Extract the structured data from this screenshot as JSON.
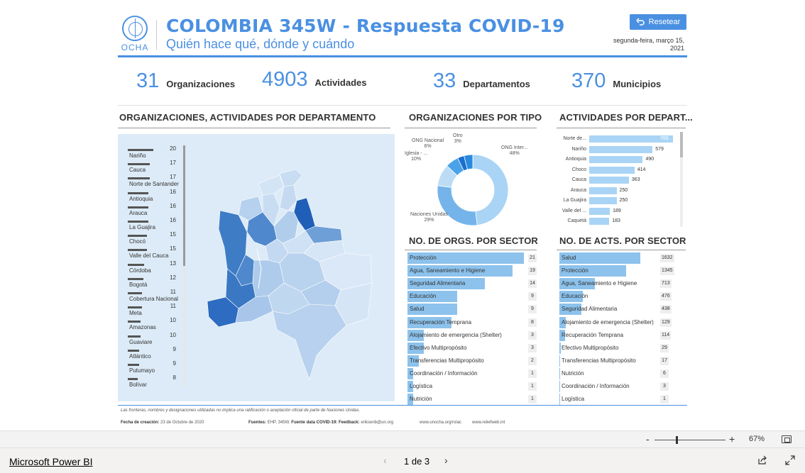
{
  "header": {
    "logo_text": "OCHA",
    "title": "COLOMBIA 345W - Respuesta COVID-19",
    "subtitle": "Quién hace qué, dónde y cuándo",
    "reset_label": "Resetear",
    "date": "segunda-feira, março 15, 2021",
    "accent_color": "#4a90e2"
  },
  "kpis": [
    {
      "value": "31",
      "label": "Organizaciones"
    },
    {
      "value": "4903",
      "label": "Actividades"
    },
    {
      "value": "33",
      "label": "Departamentos"
    },
    {
      "value": "370",
      "label": "Municipios"
    }
  ],
  "sections": {
    "map_title": "ORGANIZACIONES, ACTIVIDADES POR DEPARTAMENTO",
    "tipo_title": "ORGANIZACIONES POR TIPO",
    "act_depto_title": "ACTIVIDADES POR DEPART...",
    "orgs_sector_title": "NO. DE ORGS. POR SECTOR",
    "acts_sector_title": "NO. DE ACTS. POR SECTOR"
  },
  "map_legend": [
    {
      "name": "Nariño",
      "value": 20
    },
    {
      "name": "Cauca",
      "value": 17
    },
    {
      "name": "Norte de Santander",
      "value": 17
    },
    {
      "name": "Antioquia",
      "value": 16
    },
    {
      "name": "Arauca",
      "value": 16
    },
    {
      "name": "La Guajira",
      "value": 16
    },
    {
      "name": "Chocó",
      "value": 15
    },
    {
      "name": "Valle del Cauca",
      "value": 15
    },
    {
      "name": "Córdoba",
      "value": 13
    },
    {
      "name": "Bogotá",
      "value": 12
    },
    {
      "name": "Cobertura Nacional",
      "value": 11
    },
    {
      "name": "Meta",
      "value": 11
    },
    {
      "name": "Amazonas",
      "value": 10
    },
    {
      "name": "Guaviare",
      "value": 10
    },
    {
      "name": "Atlántico",
      "value": 9
    },
    {
      "name": "Putumayo",
      "value": 9
    },
    {
      "name": "Bolívar",
      "value": 8
    }
  ],
  "donut": {
    "segments": [
      {
        "label": "ONG Inter...",
        "pct_label": "48%",
        "value": 48,
        "color": "#a9d4f5"
      },
      {
        "label": "Naciones Unidas",
        "pct_label": "29%",
        "value": 29,
        "color": "#74b4ea"
      },
      {
        "label": "Iglesia - ...",
        "pct_label": "10%",
        "value": 10,
        "color": "#bcdcf5"
      },
      {
        "label": "ONG Nacional",
        "pct_label": "6%",
        "value": 6,
        "color": "#4aa3e8"
      },
      {
        "label": "Otro",
        "pct_label": "3%",
        "value": 3,
        "color": "#1a6fd0"
      },
      {
        "label": "",
        "pct_label": "",
        "value": 4,
        "color": "#2a8ae0"
      }
    ]
  },
  "act_depto": [
    {
      "name": "Norte de...",
      "value": 766
    },
    {
      "name": "Nariño",
      "value": 579
    },
    {
      "name": "Antioquia",
      "value": 490
    },
    {
      "name": "Choco",
      "value": 414
    },
    {
      "name": "Cauca",
      "value": 363
    },
    {
      "name": "Arauca",
      "value": 250
    },
    {
      "name": "La Guajira",
      "value": 250
    },
    {
      "name": "Valle del ...",
      "value": 189
    },
    {
      "name": "Caquetá",
      "value": 183
    }
  ],
  "orgs_sector": [
    {
      "name": "Protección",
      "value": 21
    },
    {
      "name": "Agua, Saneamiento e Higiene",
      "value": 19
    },
    {
      "name": "Seguridad Alimentaria",
      "value": 14
    },
    {
      "name": "Educación",
      "value": 9
    },
    {
      "name": "Salud",
      "value": 9
    },
    {
      "name": "Recuperación Temprana",
      "value": 8
    },
    {
      "name": "Alojamiento de emergencia (Shelter)",
      "value": 3
    },
    {
      "name": "Efectivo Multipropósito",
      "value": 3
    },
    {
      "name": "Transferencias Multipropósito",
      "value": 2
    },
    {
      "name": "Coordinación / Información",
      "value": 1
    },
    {
      "name": "Logística",
      "value": 1
    },
    {
      "name": "Nutrición",
      "value": 1
    }
  ],
  "acts_sector": [
    {
      "name": "Salud",
      "value": 1632
    },
    {
      "name": "Protección",
      "value": 1345
    },
    {
      "name": "Agua, Saneamiento e Higiene",
      "value": 713
    },
    {
      "name": "Educación",
      "value": 476
    },
    {
      "name": "Seguridad Alimentaria",
      "value": 438
    },
    {
      "name": "Alojamiento de emergencia (Shelter)",
      "value": 129
    },
    {
      "name": "Recuperación Temprana",
      "value": 114
    },
    {
      "name": "Efectivo Multipropósito",
      "value": 29
    },
    {
      "name": "Transferencias Multipropósito",
      "value": 17
    },
    {
      "name": "Nutrición",
      "value": 6
    },
    {
      "name": "Coordinación / Información",
      "value": 3
    },
    {
      "name": "Logística",
      "value": 1
    }
  ],
  "footer": {
    "disclaimer": "Las fronteras, nombres y designaciones utilizadas no implica una ratificación o aceptación oficial de parte de Naciones Unidas.",
    "fecha_label": "Fecha de creación:",
    "fecha_value": "23 de Octubre de 2020",
    "fuentes_label": "Fuentes:",
    "fuentes_value": "EHP, 345W.",
    "fuente_covid_label": "Fuente data COVID-19:",
    "feedback_label": "Feedback:",
    "feedback_value": "eriksenb@un.org",
    "url1": "www.unocha.org/rolac",
    "url2": "www.reliefweb.int"
  },
  "zoom": {
    "minus": "-",
    "plus": "+",
    "percent": "67%",
    "level": 0.3
  },
  "bottom": {
    "brand_link": "Microsoft Power BI",
    "page_label": "1 de 3",
    "prev": "‹",
    "next": "›"
  }
}
